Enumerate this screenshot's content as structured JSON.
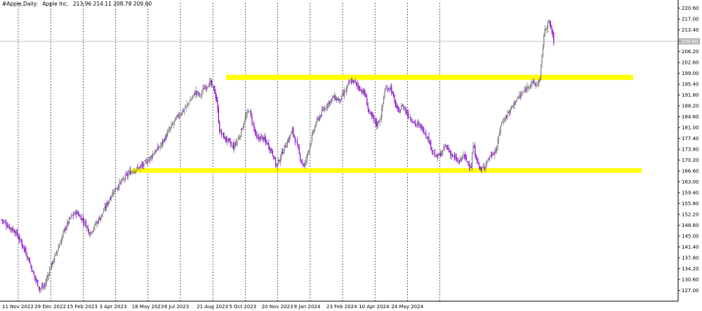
{
  "header": {
    "symbol": "#Apple,Daily:",
    "name": "Apple Inc.",
    "ohlc": "213.96 214.11 208.78 209.60"
  },
  "colors": {
    "background": "#ffffff",
    "axis": "#000000",
    "grid": "#000000",
    "bull_candle": "#7a7a7a",
    "bear_candle": "#8b00d4",
    "zone": "#ffff00",
    "price_line": "#a0a0a0",
    "price_box": "#b4b4b4"
  },
  "chart_data": {
    "type": "candlestick",
    "title": "#Apple,Daily:  Apple Inc.  213.96 214.11 208.78 209.60",
    "current_price": "209.60",
    "ylim": [
      123.4,
      222.4
    ],
    "y_ticks": [
      127.0,
      130.6,
      134.2,
      137.8,
      141.4,
      145.0,
      148.6,
      152.2,
      155.8,
      159.4,
      163.0,
      166.6,
      170.2,
      173.8,
      177.4,
      181.0,
      184.6,
      188.2,
      191.8,
      195.4,
      199.0,
      202.6,
      206.2,
      209.8,
      213.4,
      217.0,
      220.6
    ],
    "y_tick_labels": [
      "127.00",
      "130.60",
      "134.20",
      "137.80",
      "141.40",
      "145.00",
      "148.60",
      "152.20",
      "155.80",
      "159.40",
      "163.00",
      "166.60",
      "170.20",
      "173.80",
      "177.40",
      "181.00",
      "184.60",
      "188.20",
      "191.80",
      "195.40",
      "199.00",
      "202.60",
      "206.20",
      "209.80",
      "213.40",
      "217.00",
      "220.60"
    ],
    "x_tick_labels": [
      "11 Nov 2022",
      "29 Dec 2022",
      "15 Feb 2023",
      "3 Apr 2023",
      "18 May 2023",
      "6 Jul 2023",
      "21 Aug 2023",
      "5 Oct 2023",
      "20 Nov 2023",
      "8 Jan 2024",
      "23 Feb 2024",
      "10 Apr 2024",
      "24 May 2024"
    ],
    "grid": "vertical dashed",
    "zones": [
      {
        "low": 196.8,
        "high": 198.5
      },
      {
        "low": 166.0,
        "high": 167.5
      }
    ],
    "trend_points": [
      [
        0,
        150.5
      ],
      [
        8,
        148.0
      ],
      [
        14,
        146.5
      ],
      [
        20,
        143.0
      ],
      [
        27,
        138.0
      ],
      [
        33,
        132.0
      ],
      [
        39,
        127.5
      ],
      [
        44,
        128.5
      ],
      [
        48,
        133.0
      ],
      [
        54,
        138.0
      ],
      [
        60,
        143.0
      ],
      [
        64,
        147.0
      ],
      [
        70,
        151.0
      ],
      [
        76,
        153.0
      ],
      [
        84,
        150.0
      ],
      [
        90,
        146.0
      ],
      [
        96,
        149.0
      ],
      [
        102,
        152.0
      ],
      [
        108,
        156.0
      ],
      [
        114,
        160.0
      ],
      [
        122,
        163.0
      ],
      [
        130,
        166.0
      ],
      [
        138,
        167.5
      ],
      [
        144,
        168.5
      ],
      [
        150,
        170.5
      ],
      [
        156,
        173.0
      ],
      [
        162,
        175.0
      ],
      [
        168,
        178.5
      ],
      [
        174,
        182.0
      ],
      [
        180,
        185.0
      ],
      [
        186,
        187.0
      ],
      [
        192,
        190.0
      ],
      [
        198,
        193.0
      ],
      [
        202,
        191.5
      ],
      [
        206,
        194.0
      ],
      [
        212,
        196.0
      ],
      [
        216,
        194.0
      ],
      [
        219,
        190.0
      ],
      [
        222,
        180.0
      ],
      [
        226,
        178.0
      ],
      [
        232,
        176.0
      ],
      [
        236,
        174.5
      ],
      [
        242,
        178.0
      ],
      [
        248,
        184.0
      ],
      [
        252,
        187.0
      ],
      [
        256,
        182.0
      ],
      [
        260,
        177.0
      ],
      [
        264,
        178.0
      ],
      [
        270,
        176.0
      ],
      [
        276,
        172.5
      ],
      [
        280,
        168.0
      ],
      [
        286,
        173.0
      ],
      [
        292,
        177.0
      ],
      [
        296,
        180.0
      ],
      [
        300,
        176.0
      ],
      [
        304,
        171.0
      ],
      [
        308,
        168.0
      ],
      [
        312,
        173.0
      ],
      [
        316,
        178.0
      ],
      [
        320,
        182.5
      ],
      [
        326,
        186.0
      ],
      [
        332,
        189.0
      ],
      [
        338,
        191.0
      ],
      [
        344,
        190.0
      ],
      [
        350,
        193.0
      ],
      [
        354,
        196.0
      ],
      [
        358,
        196.5
      ],
      [
        362,
        195.0
      ],
      [
        366,
        193.5
      ],
      [
        370,
        192.0
      ],
      [
        374,
        186.0
      ],
      [
        378,
        184.0
      ],
      [
        382,
        182.0
      ],
      [
        386,
        184.5
      ],
      [
        390,
        193.5
      ],
      [
        396,
        194.5
      ],
      [
        400,
        189.5
      ],
      [
        404,
        186.0
      ],
      [
        408,
        188.5
      ],
      [
        412,
        186.0
      ],
      [
        418,
        183.5
      ],
      [
        422,
        182.0
      ],
      [
        426,
        181.5
      ],
      [
        430,
        180.0
      ],
      [
        434,
        177.5
      ],
      [
        438,
        174.0
      ],
      [
        442,
        171.0
      ],
      [
        448,
        172.5
      ],
      [
        452,
        175.0
      ],
      [
        458,
        172.0
      ],
      [
        462,
        170.5
      ],
      [
        466,
        169.5
      ],
      [
        470,
        172.0
      ],
      [
        474,
        169.5
      ],
      [
        478,
        168.0
      ],
      [
        480,
        175.0
      ],
      [
        484,
        170.0
      ],
      [
        488,
        166.5
      ],
      [
        492,
        168.5
      ],
      [
        496,
        171.0
      ],
      [
        500,
        172.5
      ],
      [
        504,
        174.0
      ],
      [
        508,
        182.0
      ],
      [
        512,
        184.0
      ],
      [
        516,
        186.0
      ],
      [
        520,
        188.0
      ],
      [
        524,
        190.5
      ],
      [
        528,
        191.5
      ],
      [
        532,
        193.0
      ],
      [
        536,
        195.0
      ],
      [
        540,
        196.0
      ],
      [
        544,
        195.0
      ],
      [
        548,
        197.0
      ],
      [
        552,
        212.0
      ],
      [
        556,
        216.0
      ],
      [
        559,
        214.5
      ],
      [
        562,
        209.6
      ]
    ],
    "candle_count": 563
  }
}
